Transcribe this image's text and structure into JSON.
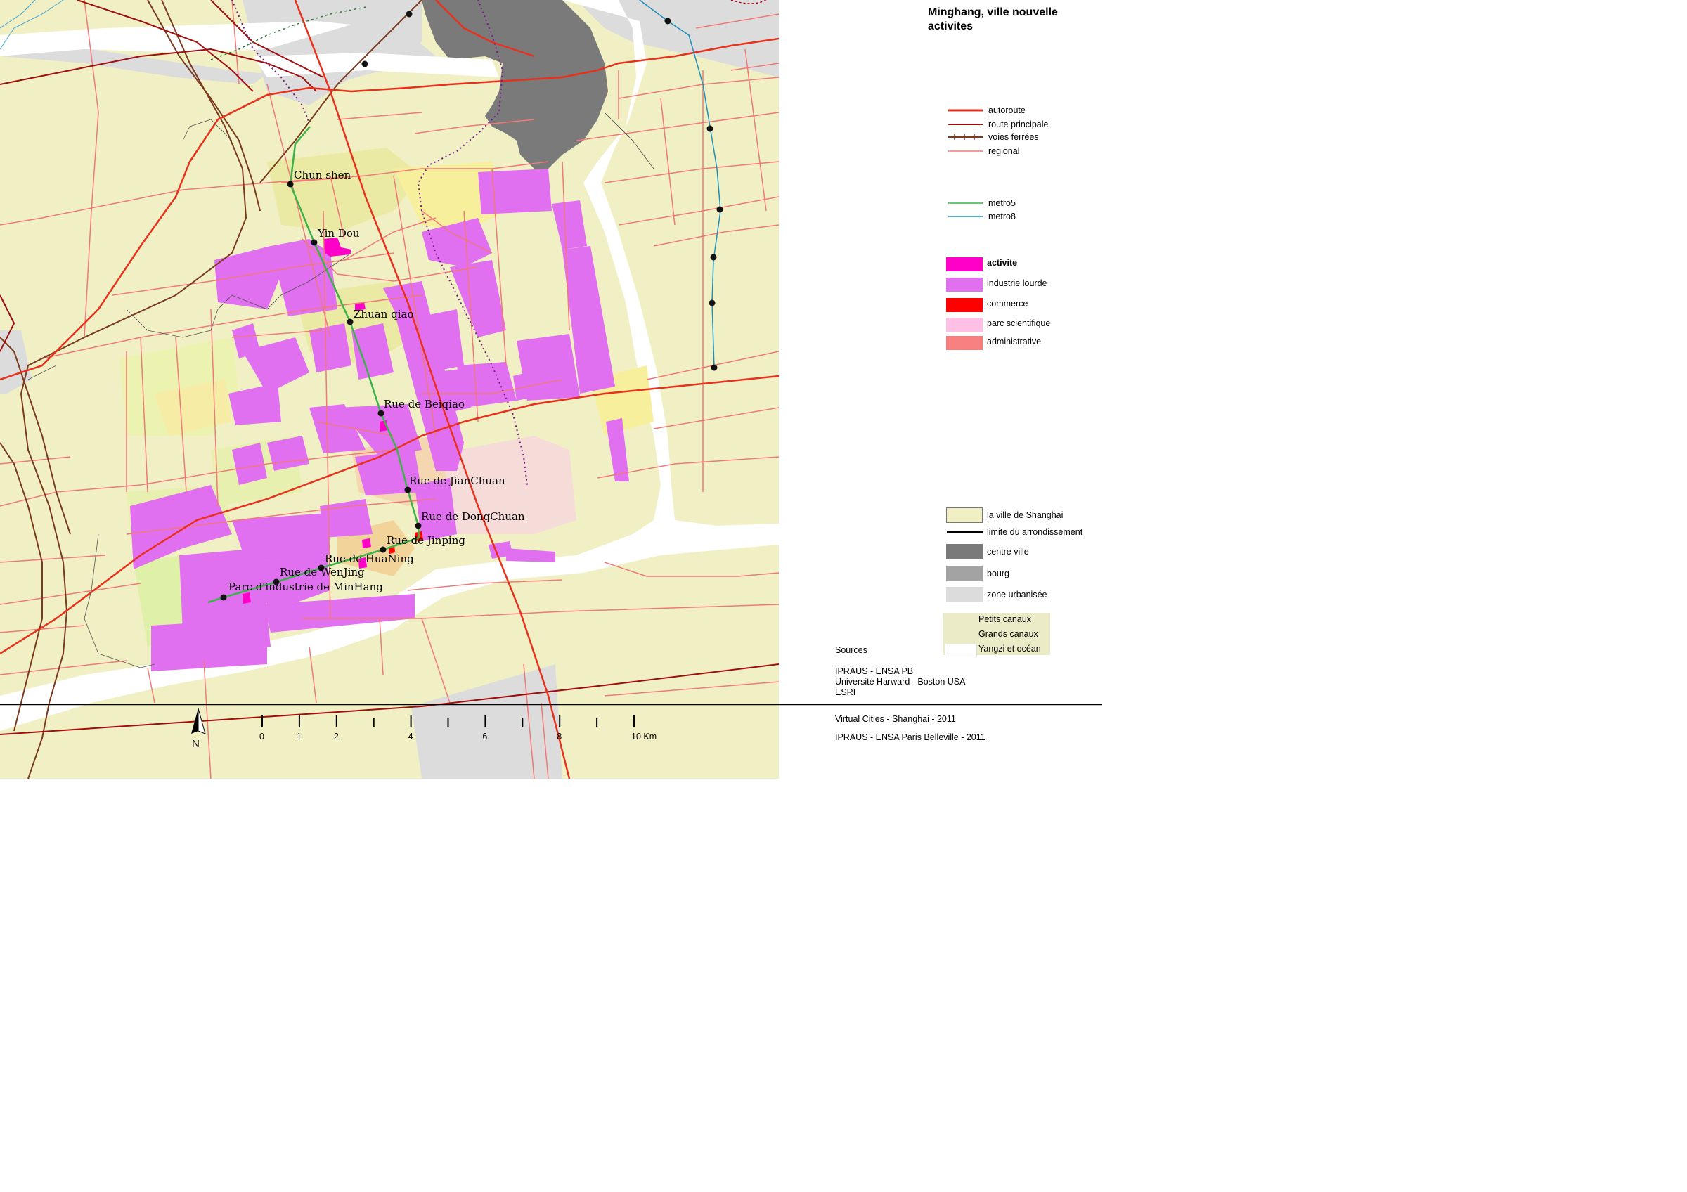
{
  "title": "Minghang, ville nouvelle\nactivites",
  "legend_lines": [
    {
      "label": "autoroute",
      "color": "#e8301c",
      "style": "solid",
      "width": 3
    },
    {
      "label": "route principale",
      "color": "#a00d0d",
      "style": "solid",
      "width": 2
    },
    {
      "label": "voies ferrées",
      "color": "#7a3a1e",
      "style": "rail",
      "width": 2
    },
    {
      "label": "regional",
      "color": "#f07878",
      "style": "solid",
      "width": 1.5
    },
    {
      "label": "metro5",
      "color": "#3cb34a",
      "style": "solid",
      "width": 1.5
    },
    {
      "label": "metro8",
      "color": "#1f8fb8",
      "style": "solid",
      "width": 1.5
    }
  ],
  "legend_areas": [
    {
      "label": "activite",
      "color": "#ff00c8",
      "bold": true
    },
    {
      "label": "industrie lourde",
      "color": "#e070f0"
    },
    {
      "label": "commerce",
      "color": "#ff0000"
    },
    {
      "label": "parc scientifique",
      "color": "#ffc0e6"
    },
    {
      "label": "administrative",
      "color": "#f78080"
    }
  ],
  "legend_base": [
    {
      "label": "la ville de Shanghai",
      "color": "#f1f0c4",
      "kind": "box"
    },
    {
      "label": "limite du arrondissement",
      "color": "#000000",
      "kind": "line"
    },
    {
      "label": "centre ville",
      "color": "#7a7a7a",
      "kind": "box"
    },
    {
      "label": "bourg",
      "color": "#a3a3a3",
      "kind": "box"
    },
    {
      "label": "zone urbanisée",
      "color": "#dcdcdc",
      "kind": "box"
    }
  ],
  "legend_canals": [
    {
      "label": "Petits canaux",
      "color": "#ecebc8"
    },
    {
      "label": "Grands canaux",
      "color": "#ecebc8"
    },
    {
      "label": "Yangzi et océan",
      "color": "#ffffff"
    }
  ],
  "sources": {
    "heading": "Sources",
    "lines": [
      "IPRAUS - ENSA PB",
      "Université Harward - Boston USA",
      "ESRI"
    ]
  },
  "footer": {
    "line1": "Virtual Cities - Shanghai - 2011",
    "line2": "IPRAUS - ENSA Paris Belleville - 2011"
  },
  "scale": {
    "labels": [
      "0",
      "1",
      "2",
      "4",
      "6",
      "8",
      "10 Km"
    ],
    "north": "N"
  },
  "stations": [
    "Chun shen",
    "Yin Dou",
    "Zhuan qiao",
    "Rue de Beiqiao",
    "Rue de JianChuan",
    "Rue de DongChuan",
    "Rue de Jinping",
    "Rue de HuaNing",
    "Rue de WenJing",
    "Parc d'industrie de MinHang"
  ],
  "colors": {
    "land": "#f1f0c4",
    "urban": "#dcdcdc",
    "center": "#7a7a7a",
    "heavy_industry": "#e070f0",
    "activity": "#ff00c8",
    "science_park": "#f6dcd8",
    "river": "#ffffff"
  }
}
